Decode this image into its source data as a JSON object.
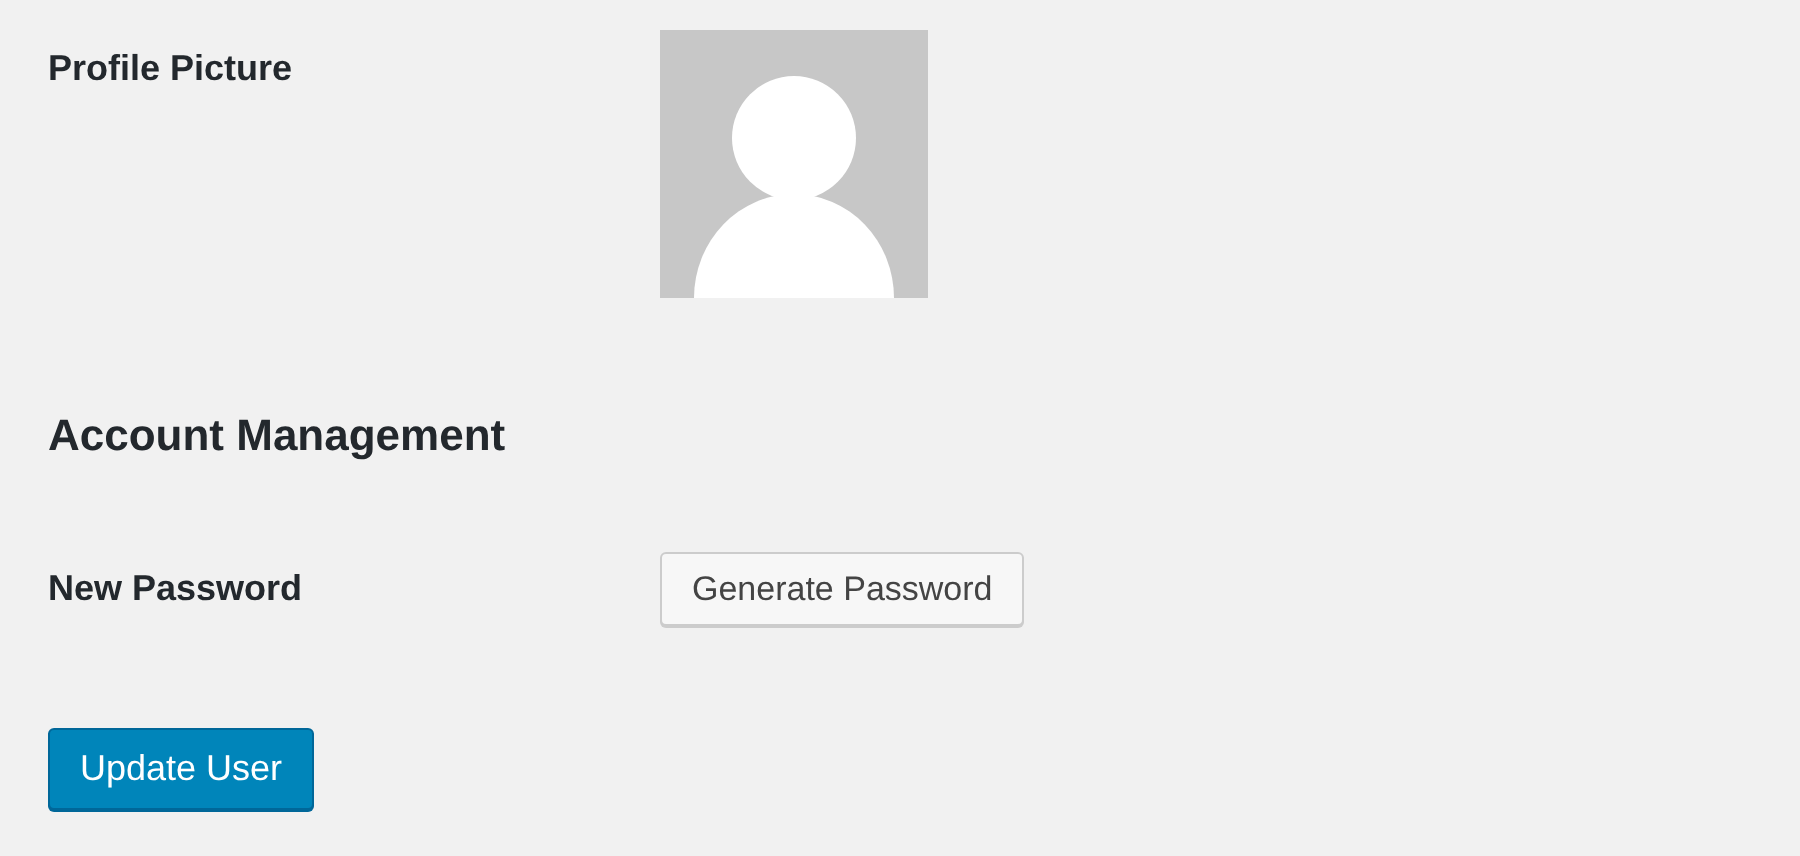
{
  "profile_picture": {
    "label": "Profile Picture",
    "kind": "picture"
  },
  "section_title": "Account Management",
  "new_password": {
    "label": "New Password",
    "button": "Generate Password"
  },
  "submit": "Update User"
}
